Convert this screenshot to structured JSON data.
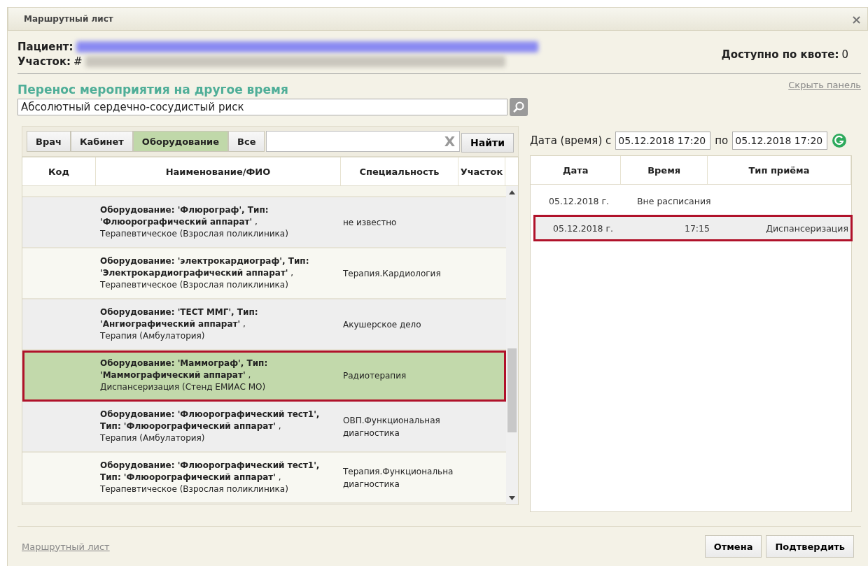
{
  "window": {
    "title": "Маршрутный лист",
    "close": "×"
  },
  "patient": {
    "label": "Пациент:",
    "area_label": "Участок:",
    "area_prefix": "#"
  },
  "quota": {
    "label": "Доступно по квоте:",
    "value": "0"
  },
  "section": {
    "title": "Перенос мероприятия на другое время",
    "hide_link": "Скрыть панель",
    "event_value": "Абсолютный сердечно-сосудистый риск"
  },
  "tabs": [
    {
      "label": "Врач",
      "selected": false
    },
    {
      "label": "Кабинет",
      "selected": false
    },
    {
      "label": "Оборудование",
      "selected": true
    },
    {
      "label": "Все",
      "selected": false
    }
  ],
  "search": {
    "clear": "X",
    "button": "Найти"
  },
  "resources": {
    "columns": [
      "Код",
      "Наименование/ФИО",
      "Специальность",
      "Участок"
    ],
    "rows": [
      {
        "name": "**Оборудование: 'Флюрограф', Тип: 'Флюорографический аппарат'** ,",
        "department": "Терапевтическое (Взрослая поликлиника)",
        "specialty": "не известно",
        "selected": false
      },
      {
        "name": "**Оборудование: 'электрокардиограф', Тип: 'Электрокардиографический аппарат'** ,",
        "department": "Терапевтическое (Взрослая поликлиника)",
        "specialty": "Терапия.Кардиология",
        "selected": false
      },
      {
        "name": "**Оборудование: 'ТЕСТ ММГ', Тип: 'Ангиографический аппарат'** ,",
        "department": "Терапия (Амбулатория)",
        "specialty": "Акушерское дело",
        "selected": false
      },
      {
        "name": "**Оборудование: 'Маммограф', Тип: 'Маммографический аппарат'** ,",
        "department": "Диспансеризация (Стенд ЕМИАС МО)",
        "specialty": "Радиотерапия",
        "selected": true
      },
      {
        "name": "**Оборудование: 'Флюорографический тест1', Тип: 'Флюорографический аппарат'** ,",
        "department": "Терапия (Амбулатория)",
        "specialty": "ОВП.Функциональная диагностика",
        "selected": false
      },
      {
        "name": "**Оборудование: 'Флюорографический тест1', Тип: 'Флюорографический аппарат'** ,",
        "department": "Терапевтическое (Взрослая поликлиника)",
        "specialty": "Терапия.Функциональна диагностика",
        "selected": false
      }
    ]
  },
  "date_range": {
    "label": "Дата (время) с",
    "from": "05.12.2018 17:20",
    "to_label": "по",
    "to": "05.12.2018 17:20"
  },
  "slots": {
    "columns": [
      "Дата",
      "Время",
      "Тип приёма"
    ],
    "rows": [
      {
        "date": "05.12.2018 г.",
        "time": "Вне расписания",
        "type": "",
        "selected": false
      },
      {
        "date": "05.12.2018 г.",
        "time": "17:15",
        "type": "Диспансеризация",
        "selected": true
      }
    ]
  },
  "footer": {
    "link": "Маршрутный лист",
    "buttons": [
      "Отмена",
      "Подтвердить"
    ]
  }
}
